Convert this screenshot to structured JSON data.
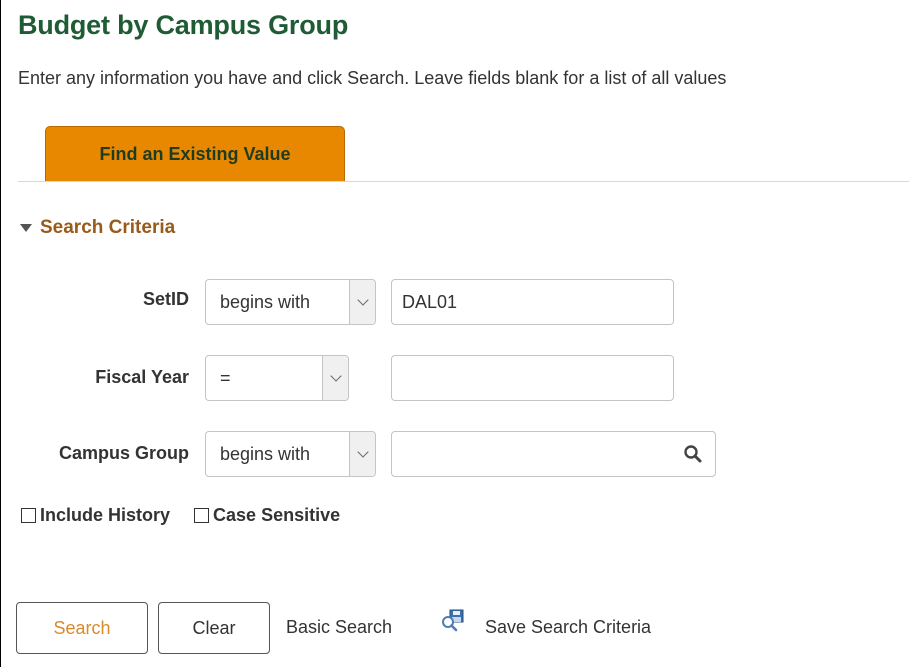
{
  "page": {
    "title": "Budget by Campus Group",
    "instructions": "Enter any information you have and click Search. Leave fields blank for a list of all values"
  },
  "tabs": [
    {
      "label": "Find an Existing Value"
    }
  ],
  "search_criteria": {
    "heading": "Search Criteria",
    "fields": [
      {
        "label": "SetID",
        "operator": "begins with",
        "value": "DAL01"
      },
      {
        "label": "Fiscal Year",
        "operator": "=",
        "value": ""
      },
      {
        "label": "Campus Group",
        "operator": "begins with",
        "value": ""
      }
    ],
    "checkboxes": [
      {
        "label": "Include History",
        "checked": false
      },
      {
        "label": "Case Sensitive",
        "checked": false
      }
    ]
  },
  "actions": {
    "search_label": "Search",
    "clear_label": "Clear",
    "basic_search_label": "Basic Search",
    "save_criteria_label": "Save Search Criteria"
  },
  "colors": {
    "title": "#1f5c35",
    "tab_active": "#e88800",
    "section_heading": "#9a5a1a",
    "search_button_text": "#d98a2b"
  }
}
